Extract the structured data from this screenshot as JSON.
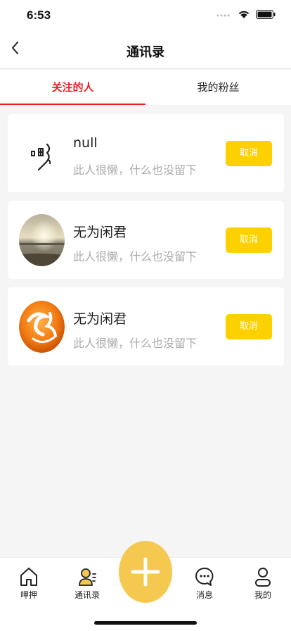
{
  "status_bar": {
    "time": "6:53"
  },
  "header": {
    "title": "通讯录"
  },
  "tabs": [
    {
      "label": "关注的人",
      "active": true
    },
    {
      "label": "我的粉丝",
      "active": false
    }
  ],
  "contacts": [
    {
      "name": "null",
      "signature": "此人很懒，什么也没留下",
      "button": "取消",
      "avatar": "handwritten-logo"
    },
    {
      "name": "无为闲君",
      "signature": "此人很懒，什么也没留下",
      "button": "取消",
      "avatar": "sunset-lake-photo"
    },
    {
      "name": "无为闲君",
      "signature": "此人很懒，什么也没留下",
      "button": "取消",
      "avatar": "orange-swirl-logo"
    }
  ],
  "bottom_nav": [
    {
      "label": "呷押",
      "icon": "home-icon"
    },
    {
      "label": "通讯录",
      "icon": "contacts-icon"
    },
    {
      "label": "",
      "icon": "plus-icon"
    },
    {
      "label": "消息",
      "icon": "message-icon"
    },
    {
      "label": "我的",
      "icon": "profile-icon"
    }
  ],
  "colors": {
    "accent": "#ee1c25",
    "button": "#fdd000",
    "fab": "#f5c94f"
  }
}
